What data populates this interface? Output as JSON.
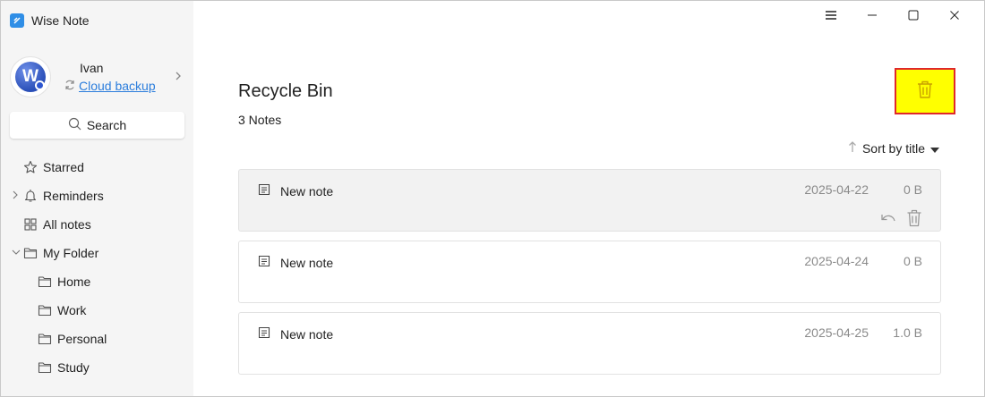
{
  "app": {
    "title": "Wise Note"
  },
  "profile": {
    "name": "Ivan",
    "cloud_label": "Cloud backup",
    "avatar_letter": "W"
  },
  "search": {
    "label": "Search"
  },
  "sidebar": {
    "items": [
      {
        "label": "Starred",
        "icon": "star-icon"
      },
      {
        "label": "Reminders",
        "icon": "bell-icon"
      },
      {
        "label": "All notes",
        "icon": "grid-icon"
      },
      {
        "label": "My Folder",
        "icon": "folder-icon"
      },
      {
        "label": "Home",
        "icon": "folder-icon"
      },
      {
        "label": "Work",
        "icon": "folder-icon"
      },
      {
        "label": "Personal",
        "icon": "folder-icon"
      },
      {
        "label": "Study",
        "icon": "folder-icon"
      }
    ]
  },
  "main": {
    "title": "Recycle Bin",
    "count_label": "3 Notes",
    "sort_label": "Sort by title",
    "notes": [
      {
        "title": "New note",
        "date": "2025-04-22",
        "size": "0 B"
      },
      {
        "title": "New note",
        "date": "2025-04-24",
        "size": "0 B"
      },
      {
        "title": "New note",
        "date": "2025-04-25",
        "size": "1.0 B"
      }
    ]
  },
  "colors": {
    "accent": "#2b7ddc",
    "highlight": "#ffff00",
    "highlight_border": "#e0282a"
  }
}
